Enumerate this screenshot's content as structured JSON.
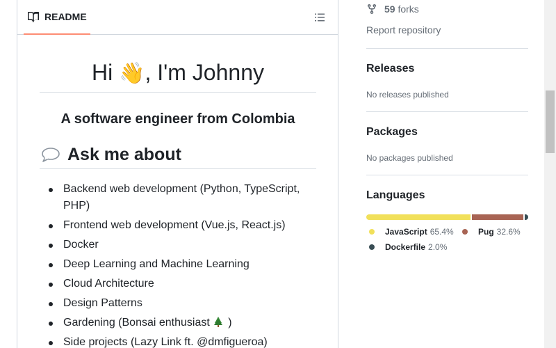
{
  "readme": {
    "tab_label": "README",
    "h1_prefix": "Hi ",
    "h1_emoji": "👋",
    "h1_suffix": ", I'm Johnny",
    "subtitle": "A software engineer from Colombia",
    "section_title": "Ask me about",
    "items": [
      "Backend web development (Python, TypeScript, PHP)",
      "Frontend web development (Vue.js, React.js)",
      "Docker",
      "Deep Learning and Machine Learning",
      "Cloud Architecture",
      "Design Patterns",
      "Gardening (Bonsai enthusiast",
      "Side projects (Lazy Link ft. @dmfigueroa)"
    ],
    "gardening_suffix": " )"
  },
  "sidebar": {
    "forks_count": "59",
    "forks_label": "forks",
    "report_label": "Report repository",
    "releases_title": "Releases",
    "releases_note": "No releases published",
    "packages_title": "Packages",
    "packages_note": "No packages published",
    "languages_title": "Languages",
    "languages": [
      {
        "name": "JavaScript",
        "percent": "65.4%",
        "value": 65.4,
        "color": "#f1e05a"
      },
      {
        "name": "Pug",
        "percent": "32.6%",
        "value": 32.6,
        "color": "#a86454"
      },
      {
        "name": "Dockerfile",
        "percent": "2.0%",
        "value": 2.0,
        "color": "#384d54"
      }
    ]
  },
  "icons": {
    "readme_tab": "book-icon",
    "outline": "list-icon",
    "section": "speech-balloon-icon",
    "forks": "fork-icon",
    "bonsai": "tree-icon"
  }
}
